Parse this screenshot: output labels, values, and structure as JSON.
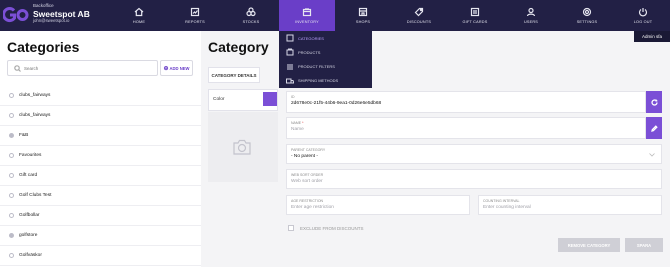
{
  "brand": {
    "product": "Backoffice",
    "company": "Sweetspot AB",
    "email": "john@sweetspot.io"
  },
  "nav": [
    {
      "label": "Home",
      "icon": "home-icon"
    },
    {
      "label": "Reports",
      "icon": "reports-icon"
    },
    {
      "label": "Stocks",
      "icon": "stocks-icon"
    },
    {
      "label": "Inventory",
      "icon": "inventory-icon",
      "active": true
    },
    {
      "label": "Shops",
      "icon": "shops-icon"
    },
    {
      "label": "Discounts",
      "icon": "discounts-icon"
    },
    {
      "label": "Gift cards",
      "icon": "gift-cards-icon"
    },
    {
      "label": "Users",
      "icon": "users-icon"
    },
    {
      "label": "Settings",
      "icon": "settings-icon"
    },
    {
      "label": "Log out",
      "icon": "log-out-icon"
    }
  ],
  "inventory_menu": [
    {
      "label": "Categories",
      "selected": true
    },
    {
      "label": "Products"
    },
    {
      "label": "Product filters"
    },
    {
      "label": "Shipping methods"
    }
  ],
  "admin_badge": "Admin sfa",
  "left": {
    "title": "Categories",
    "search_placeholder": "Search",
    "add_new": "ADD NEW",
    "items": [
      {
        "label": "clubs_fairways",
        "checked": false
      },
      {
        "label": "clubs_fairways",
        "checked": false
      },
      {
        "label": "F&B",
        "checked": true
      },
      {
        "label": "Favourites",
        "checked": false
      },
      {
        "label": "Gift card",
        "checked": false
      },
      {
        "label": "Golf Clubs Test",
        "checked": false
      },
      {
        "label": "Golfbollar",
        "checked": false
      },
      {
        "label": "golfstore",
        "checked": true
      },
      {
        "label": "Golfväskor",
        "checked": false
      }
    ]
  },
  "detail": {
    "title": "Category",
    "tab": "Category details",
    "color_label": "Color",
    "id_label": "ID",
    "id_value": "2d678e0c-21f5-44b6-9ea1-0d26e6e5db68",
    "name_label": "Name",
    "name_required": "*",
    "name_placeholder": "Name",
    "parent_label": "Parent category",
    "parent_value": "- No parent -",
    "sort_label": "Web sort order",
    "sort_placeholder": "Web sort order",
    "age_label": "Age restriction",
    "age_placeholder": "Enter age restriction",
    "counting_label": "Counting interval",
    "counting_placeholder": "Enter counting interval",
    "exclude_label": "Exclude from discounts",
    "remove_button": "Remove category",
    "save_button": "Spara"
  },
  "colors": {
    "topbar": "#222045",
    "accent": "#7b4fd6",
    "active_nav": "#6a3ec8"
  }
}
